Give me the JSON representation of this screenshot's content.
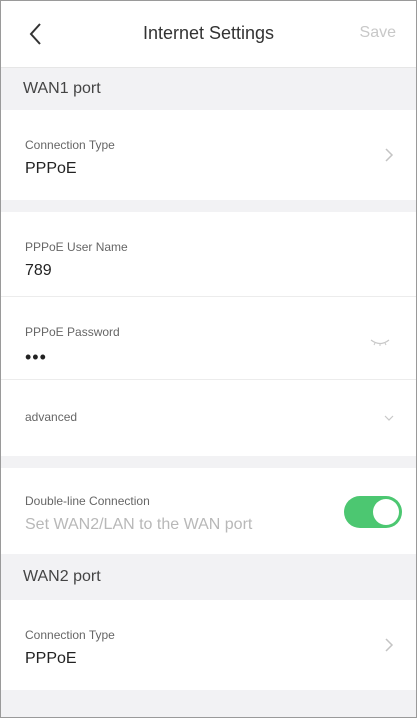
{
  "header": {
    "title": "Internet Settings",
    "save_label": "Save",
    "back_icon": "chevron-left-icon"
  },
  "wan1": {
    "section_label": "WAN1 port",
    "connection_type": {
      "label": "Connection Type",
      "value": "PPPoE"
    },
    "user_name": {
      "label": "PPPoE User Name",
      "value": "789"
    },
    "password": {
      "label": "PPPoE Password",
      "value": "•••"
    },
    "advanced": {
      "label": "advanced"
    }
  },
  "double_line": {
    "label": "Double-line Connection",
    "hint": "Set WAN2/LAN to the WAN port",
    "enabled": true
  },
  "wan2": {
    "section_label": "WAN2 port",
    "connection_type": {
      "label": "Connection Type",
      "value": "PPPoE"
    }
  },
  "colors": {
    "toggle_on": "#4cc771",
    "save_disabled": "#c8c8c8"
  }
}
